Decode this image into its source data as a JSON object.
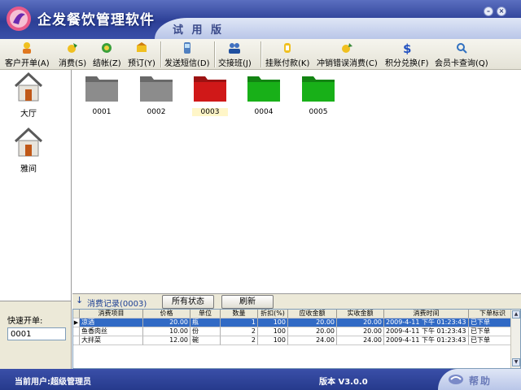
{
  "app": {
    "title": "企发餐饮管理软件",
    "edition": "试 用 版",
    "min_symbol": "–",
    "close_symbol": "×"
  },
  "toolbar": {
    "items": [
      {
        "label": "客户开单(A)",
        "icon": "customer-order-icon"
      },
      {
        "label": "消费(S)",
        "icon": "consume-icon"
      },
      {
        "label": "结帐(Z)",
        "icon": "checkout-icon"
      },
      {
        "label": "预订(Y)",
        "icon": "reserve-icon"
      },
      {
        "label": "发送短信(D)",
        "icon": "sms-icon"
      },
      {
        "label": "交接班(J)",
        "icon": "shift-handover-icon"
      },
      {
        "label": "挂账付款(K)",
        "icon": "credit-payment-icon"
      },
      {
        "label": "冲销错误消费(C)",
        "icon": "reverse-consume-icon"
      },
      {
        "label": "积分兑换(F)",
        "icon": "points-exchange-icon"
      },
      {
        "label": "会员卡查询(Q)",
        "icon": "member-card-search-icon"
      }
    ]
  },
  "rooms": [
    {
      "label": "大厅"
    },
    {
      "label": "雅间"
    }
  ],
  "tables": [
    {
      "label": "0001",
      "status": "idle",
      "color": "#8c8c8c"
    },
    {
      "label": "0002",
      "status": "idle",
      "color": "#8c8c8c"
    },
    {
      "label": "0003",
      "status": "selected",
      "color": "#d01818"
    },
    {
      "label": "0004",
      "status": "occupied",
      "color": "#18b018"
    },
    {
      "label": "0005",
      "status": "occupied",
      "color": "#18b018"
    }
  ],
  "quick_open": {
    "label": "快速开单:",
    "value": "0001"
  },
  "records": {
    "title": "消费记录(0003)",
    "arrow": "↓",
    "all_status_button": "所有状态",
    "refresh_button": "刷新",
    "columns": [
      "消费项目",
      "价格",
      "单位",
      "数量",
      "折扣(%)",
      "应收金额",
      "实收金额",
      "消费时间",
      "下单标识"
    ],
    "rows": [
      {
        "item": "凉酒",
        "price": "20.00",
        "unit": "瓶",
        "qty": "1",
        "discount": "100",
        "due": "20.00",
        "paid": "20.00",
        "time": "2009-4-11 下午 01:23:43",
        "flag": "已下单"
      },
      {
        "item": "鱼香肉丝",
        "price": "10.00",
        "unit": "份",
        "qty": "2",
        "discount": "100",
        "due": "20.00",
        "paid": "20.00",
        "time": "2009-4-11 下午 01:23:43",
        "flag": "已下单"
      },
      {
        "item": "大拌菜",
        "price": "12.00",
        "unit": "碗",
        "qty": "2",
        "discount": "100",
        "due": "24.00",
        "paid": "24.00",
        "time": "2009-4-11 下午 01:23:43",
        "flag": "已下单"
      }
    ]
  },
  "status": {
    "user": "当前用户:超级管理员",
    "version": "版本 V3.0.0",
    "help": "帮助"
  }
}
